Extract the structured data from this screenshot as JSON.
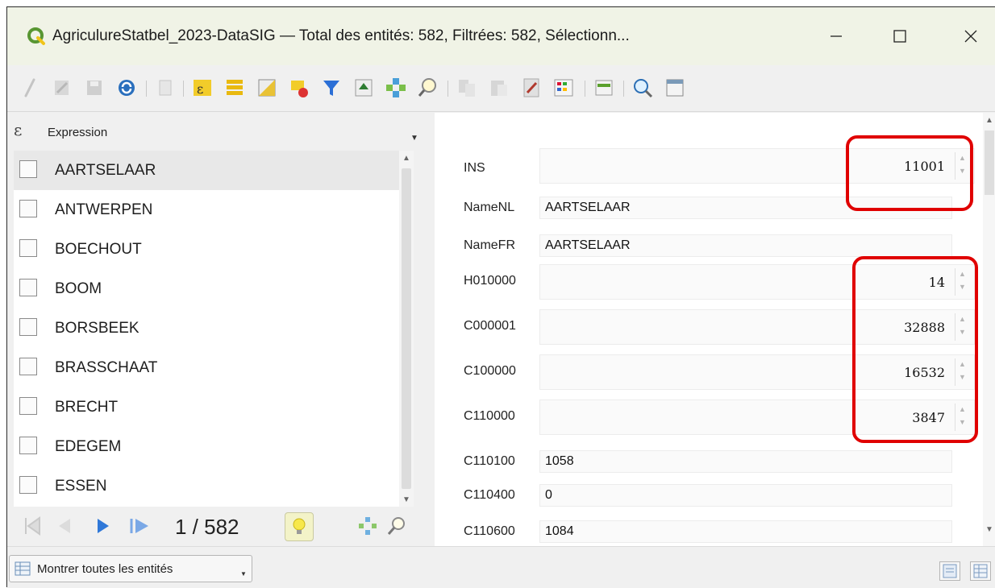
{
  "window": {
    "title": "AgriculureStatbel_2023-DataSIG — Total des entités: 582, Filtrées: 582, Sélectionn...",
    "minimize_icon": "minimize-icon",
    "maximize_icon": "maximize-icon",
    "close_icon": "close-icon"
  },
  "expression": {
    "label": "Expression"
  },
  "features": [
    "AARTSELAAR",
    "ANTWERPEN",
    "BOECHOUT",
    "BOOM",
    "BORSBEEK",
    "BRASSCHAAT",
    "BRECHT",
    "EDEGEM",
    "ESSEN"
  ],
  "navigation": {
    "counter": "1 / 582"
  },
  "form": {
    "ins": {
      "label": "INS",
      "value": "11001"
    },
    "namenl": {
      "label": "NameNL",
      "value": "AARTSELAAR"
    },
    "namefr": {
      "label": "NameFR",
      "value": "AARTSELAAR"
    },
    "h010000": {
      "label": "H010000",
      "value": "14"
    },
    "c000001": {
      "label": "C000001",
      "value": "32888"
    },
    "c100000": {
      "label": "C100000",
      "value": "16532"
    },
    "c110000": {
      "label": "C110000",
      "value": "3847"
    },
    "c110100": {
      "label": "C110100",
      "value": "1058"
    },
    "c110400": {
      "label": "C110400",
      "value": "0"
    },
    "c110600": {
      "label": "C110600",
      "value": "1084"
    }
  },
  "bottombar": {
    "show_all_label": "Montrer toutes les entités"
  },
  "colors": {
    "highlight": "#e00000",
    "qgis_green": "#589632",
    "qgis_yellow": "#f0c419"
  }
}
